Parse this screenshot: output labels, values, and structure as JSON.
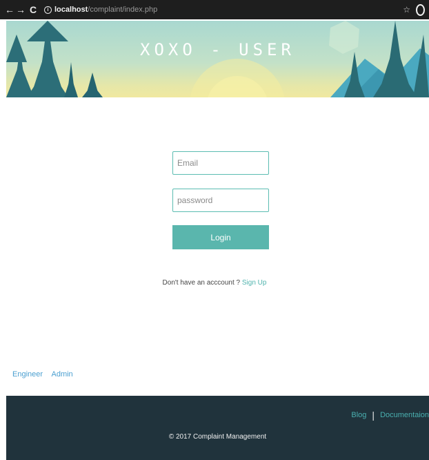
{
  "browser": {
    "url_host": "localhost",
    "url_path": "/complaint/index.php"
  },
  "banner": {
    "title": "XOXO - USER"
  },
  "login_form": {
    "email_placeholder": "Email",
    "password_placeholder": "password",
    "login_label": "Login",
    "signup_prompt": "Don't have an acccount ?",
    "signup_link": "Sign Up"
  },
  "role_links": {
    "engineer": "Engineer",
    "admin": "Admin"
  },
  "footer": {
    "blog": "Blog",
    "separator": "|",
    "documentation": "Documentaion",
    "copyright": "© 2017 Complaint Management"
  },
  "colors": {
    "accent": "#5ab6ad",
    "footer_bg": "#20333c",
    "link": "#4a9fd0"
  },
  "icons": {
    "back": "arrow-left-icon",
    "forward": "arrow-right-icon",
    "reload": "reload-icon",
    "info": "info-icon",
    "star": "star-icon",
    "extension": "extension-icon"
  }
}
